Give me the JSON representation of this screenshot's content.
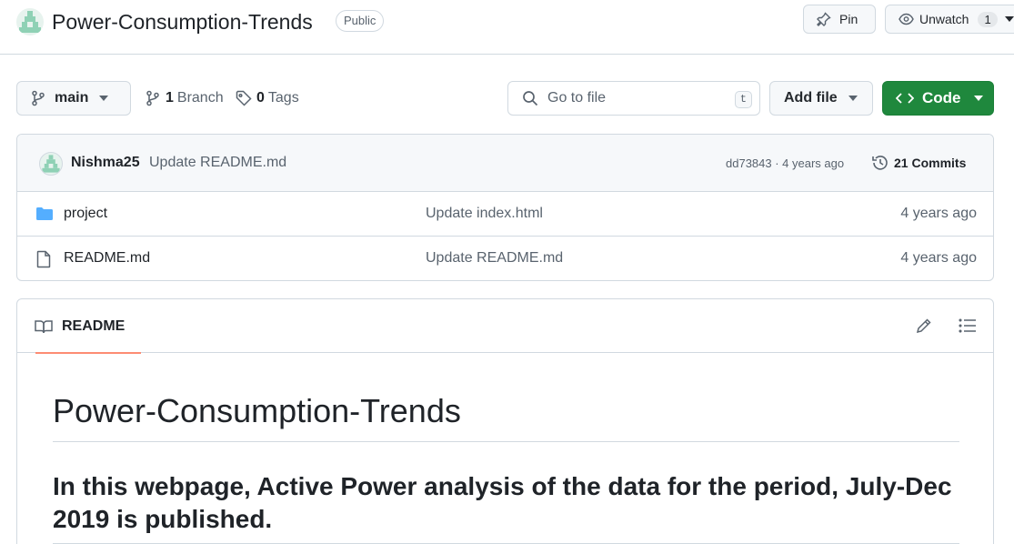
{
  "header": {
    "repo_name": "Power-Consumption-Trends",
    "visibility": "Public",
    "pin_label": "Pin",
    "unwatch_label": "Unwatch",
    "watch_count": "1"
  },
  "toolbar": {
    "branch": "main",
    "branches_count": "1",
    "branches_label": "Branch",
    "tags_count": "0",
    "tags_label": "Tags",
    "search_placeholder": "Go to file",
    "search_shortcut": "t",
    "add_file_label": "Add file",
    "code_label": "Code",
    "code_color": "#1f883d"
  },
  "latest_commit": {
    "author": "Nishma25",
    "message": "Update README.md",
    "hash_age": "dd73843 · 4 years ago",
    "commits_label": "21 Commits"
  },
  "files": [
    {
      "icon": "folder-icon",
      "name": "project",
      "commit": "Update index.html",
      "age": "4 years ago"
    },
    {
      "icon": "file-icon",
      "name": "README.md",
      "commit": "Update README.md",
      "age": "4 years ago"
    }
  ],
  "readme": {
    "tab_label": "README",
    "h1": "Power-Consumption-Trends",
    "h2": "In this webpage, Active Power analysis of the data for the period, July-Dec 2019 is published."
  }
}
